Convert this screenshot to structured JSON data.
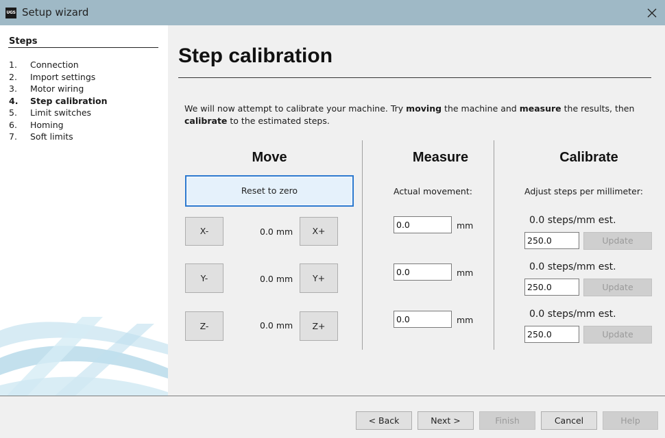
{
  "window": {
    "title": "Setup wizard",
    "app_icon_text": "UGS"
  },
  "sidebar": {
    "heading": "Steps",
    "steps": [
      {
        "num": "1.",
        "label": "Connection",
        "active": false
      },
      {
        "num": "2.",
        "label": "Import settings",
        "active": false
      },
      {
        "num": "3.",
        "label": "Motor wiring",
        "active": false
      },
      {
        "num": "4.",
        "label": "Step calibration",
        "active": true
      },
      {
        "num": "5.",
        "label": "Limit switches",
        "active": false
      },
      {
        "num": "6.",
        "label": "Homing",
        "active": false
      },
      {
        "num": "7.",
        "label": "Soft limits",
        "active": false
      }
    ]
  },
  "main": {
    "title": "Step calibration",
    "intro": {
      "p1": "We will now attempt to calibrate your machine. Try ",
      "b1": "moving",
      "p2": " the machine and ",
      "b2": "measure",
      "p3": " the results, then ",
      "b3": "calibrate",
      "p4": " to the estimated steps."
    },
    "move": {
      "heading": "Move",
      "reset_label": "Reset to zero",
      "axes": [
        {
          "minus": "X-",
          "plus": "X+",
          "position": "0.0 mm"
        },
        {
          "minus": "Y-",
          "plus": "Y+",
          "position": "0.0 mm"
        },
        {
          "minus": "Z-",
          "plus": "Z+",
          "position": "0.0 mm"
        }
      ]
    },
    "measure": {
      "heading": "Measure",
      "label": "Actual movement:",
      "unit": "mm",
      "values": [
        "0.0",
        "0.0",
        "0.0"
      ]
    },
    "calibrate": {
      "heading": "Calibrate",
      "label": "Adjust steps per millimeter:",
      "rows": [
        {
          "estimate": "0.0 steps/mm est.",
          "value": "250.0",
          "update_label": "Update"
        },
        {
          "estimate": "0.0 steps/mm est.",
          "value": "250.0",
          "update_label": "Update"
        },
        {
          "estimate": "0.0 steps/mm est.",
          "value": "250.0",
          "update_label": "Update"
        }
      ]
    }
  },
  "footer": {
    "back": "< Back",
    "next": "Next >",
    "finish": "Finish",
    "cancel": "Cancel",
    "help": "Help"
  },
  "colors": {
    "titlebar": "#9fb9c6",
    "focus_border": "#2a78cf",
    "sidebar_art": "#a9d3e6"
  }
}
